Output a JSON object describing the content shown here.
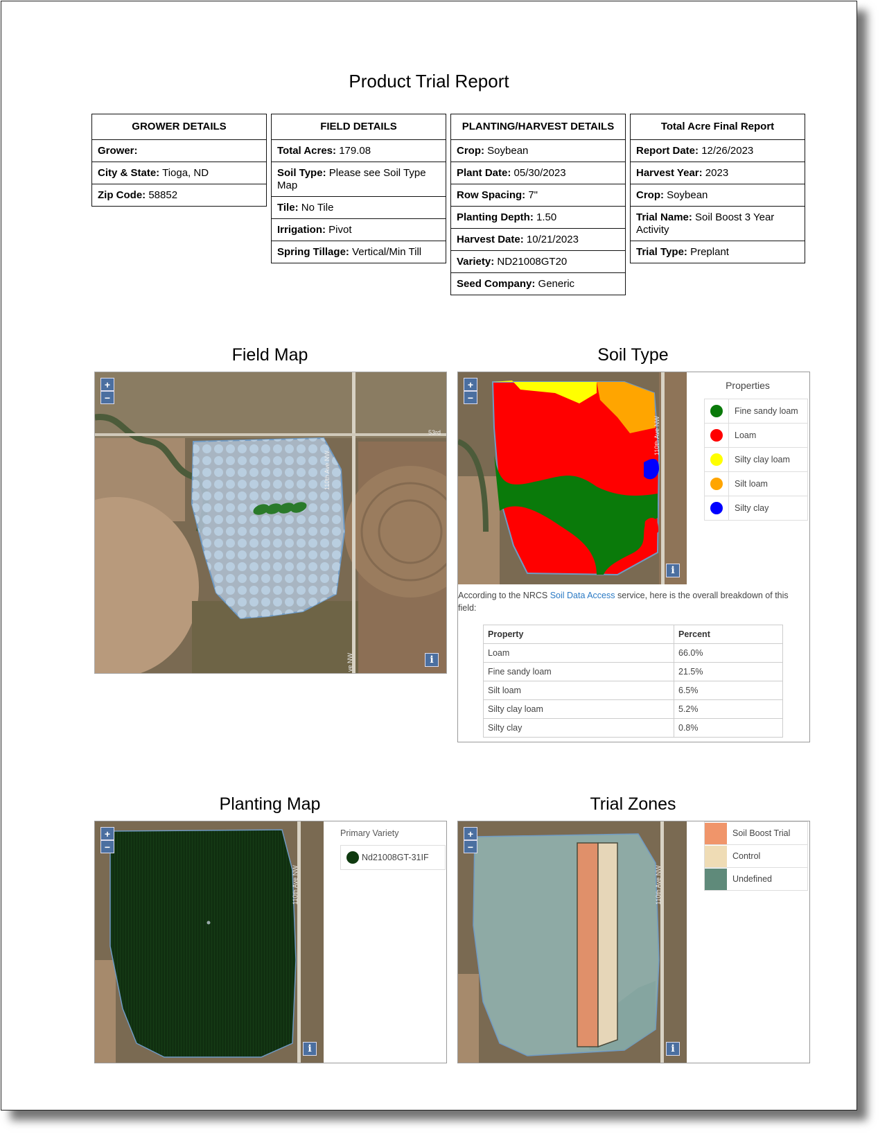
{
  "report_title": "Product Trial Report",
  "grower_details": {
    "header": "GROWER DETAILS",
    "rows": [
      {
        "label": "Grower:",
        "value": ""
      },
      {
        "label": "City & State:",
        "value": "Tioga, ND"
      },
      {
        "label": "Zip Code:",
        "value": "58852"
      }
    ]
  },
  "field_details": {
    "header": "FIELD DETAILS",
    "rows": [
      {
        "label": "Total Acres:",
        "value": "179.08"
      },
      {
        "label": "Soil Type:",
        "value": "Please see Soil Type Map"
      },
      {
        "label": "Tile:",
        "value": "No Tile"
      },
      {
        "label": "Irrigation:",
        "value": "Pivot"
      },
      {
        "label": "Spring Tillage:",
        "value": "Vertical/Min Till"
      }
    ]
  },
  "planting_harvest_details": {
    "header": "PLANTING/HARVEST DETAILS",
    "rows": [
      {
        "label": "Crop:",
        "value": "Soybean"
      },
      {
        "label": "Plant Date:",
        "value": "05/30/2023"
      },
      {
        "label": "Row Spacing:",
        "value": "7\""
      },
      {
        "label": "Planting Depth:",
        "value": "1.50"
      },
      {
        "label": "Harvest Date:",
        "value": "10/21/2023"
      },
      {
        "label": "Variety:",
        "value": "ND21008GT20"
      },
      {
        "label": "Seed Company:",
        "value": "Generic"
      }
    ]
  },
  "total_acre_report": {
    "header": "Total Acre Final Report",
    "rows": [
      {
        "label": "Report Date:",
        "value": "12/26/2023"
      },
      {
        "label": "Harvest Year:",
        "value": "2023"
      },
      {
        "label": "Crop:",
        "value": "Soybean"
      },
      {
        "label": "Trial Name:",
        "value": "Soil Boost 3 Year Activity"
      },
      {
        "label": "Trial Type:",
        "value": "Preplant"
      }
    ]
  },
  "map_controls": {
    "zoom_in": "+",
    "zoom_out": "−",
    "info": "i"
  },
  "field_map": {
    "title": "Field Map",
    "road_labels": {
      "road_53rd": "53rd",
      "ave_110th": "110th Ave NW",
      "ave_bottom": "ve NW"
    }
  },
  "soil_type": {
    "title": "Soil Type",
    "legend_title": "Properties",
    "legend": [
      {
        "label": "Fine sandy loam",
        "color": "#0a7a0a"
      },
      {
        "label": "Loam",
        "color": "#ff0000"
      },
      {
        "label": "Silty clay loam",
        "color": "#ffff00"
      },
      {
        "label": "Silt loam",
        "color": "#ffa500"
      },
      {
        "label": "Silty clay",
        "color": "#0000ff"
      }
    ],
    "road_label": "110th Ave NW",
    "description_pre": "According to the NRCS",
    "description_link": "Soil Data Access",
    "description_post": "service, here is the overall breakdown of this field:",
    "table_headers": {
      "property": "Property",
      "percent": "Percent"
    },
    "table_rows": [
      {
        "property": "Loam",
        "percent": "66.0%"
      },
      {
        "property": "Fine sandy loam",
        "percent": "21.5%"
      },
      {
        "property": "Silt loam",
        "percent": "6.5%"
      },
      {
        "property": "Silty clay loam",
        "percent": "5.2%"
      },
      {
        "property": "Silty clay",
        "percent": "0.8%"
      }
    ]
  },
  "planting_map": {
    "title": "Planting Map",
    "legend_title": "Primary Variety",
    "legend": [
      {
        "label": "Nd21008GT-31IF",
        "color": "#0f3a10"
      }
    ],
    "road_label": "110th Ave NW"
  },
  "trial_zones": {
    "title": "Trial Zones",
    "legend": [
      {
        "label": "Soil Boost Trial",
        "color": "#f0956a"
      },
      {
        "label": "Control",
        "color": "#efdcb5"
      },
      {
        "label": "Undefined",
        "color": "#5f8a7a"
      }
    ],
    "road_label": "110th Ave NW"
  }
}
